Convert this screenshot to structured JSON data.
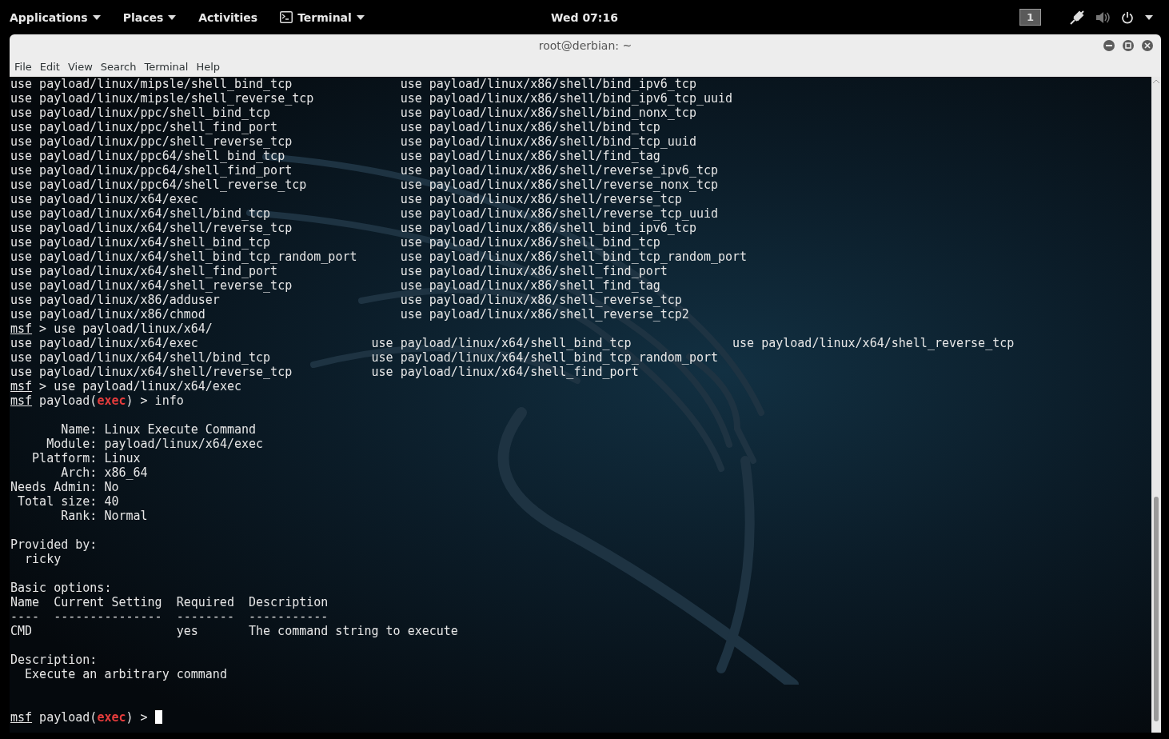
{
  "top_bar": {
    "menus": [
      {
        "label": "Applications",
        "dropdown": true
      },
      {
        "label": "Places",
        "dropdown": true
      },
      {
        "label": "Activities",
        "dropdown": false
      },
      {
        "label": "Terminal",
        "dropdown": true,
        "app_icon": true
      }
    ],
    "clock": "Wed 07:16",
    "workspace": "1"
  },
  "window": {
    "title": "root@derbian: ~",
    "menu": [
      "File",
      "Edit",
      "View",
      "Search",
      "Terminal",
      "Help"
    ]
  },
  "terminal": {
    "lines": [
      {
        "kind": "wide-listing",
        "cells": [
          "use payload/linux/mipsle/shell_bind_tcp",
          "use payload/linux/x86/shell/bind_ipv6_tcp"
        ]
      },
      {
        "kind": "wide-listing",
        "cells": [
          "use payload/linux/mipsle/shell_reverse_tcp",
          "use payload/linux/x86/shell/bind_ipv6_tcp_uuid"
        ]
      },
      {
        "kind": "wide-listing",
        "cells": [
          "use payload/linux/ppc/shell_bind_tcp",
          "use payload/linux/x86/shell/bind_nonx_tcp"
        ]
      },
      {
        "kind": "wide-listing",
        "cells": [
          "use payload/linux/ppc/shell_find_port",
          "use payload/linux/x86/shell/bind_tcp"
        ]
      },
      {
        "kind": "wide-listing",
        "cells": [
          "use payload/linux/ppc/shell_reverse_tcp",
          "use payload/linux/x86/shell/bind_tcp_uuid"
        ]
      },
      {
        "kind": "wide-listing",
        "cells": [
          "use payload/linux/ppc64/shell_bind_tcp",
          "use payload/linux/x86/shell/find_tag"
        ]
      },
      {
        "kind": "wide-listing",
        "cells": [
          "use payload/linux/ppc64/shell_find_port",
          "use payload/linux/x86/shell/reverse_ipv6_tcp"
        ]
      },
      {
        "kind": "wide-listing",
        "cells": [
          "use payload/linux/ppc64/shell_reverse_tcp",
          "use payload/linux/x86/shell/reverse_nonx_tcp"
        ]
      },
      {
        "kind": "wide-listing",
        "cells": [
          "use payload/linux/x64/exec",
          "use payload/linux/x86/shell/reverse_tcp"
        ]
      },
      {
        "kind": "wide-listing",
        "cells": [
          "use payload/linux/x64/shell/bind_tcp",
          "use payload/linux/x86/shell/reverse_tcp_uuid"
        ]
      },
      {
        "kind": "wide-listing",
        "cells": [
          "use payload/linux/x64/shell/reverse_tcp",
          "use payload/linux/x86/shell_bind_ipv6_tcp"
        ]
      },
      {
        "kind": "wide-listing",
        "cells": [
          "use payload/linux/x64/shell_bind_tcp",
          "use payload/linux/x86/shell_bind_tcp"
        ]
      },
      {
        "kind": "wide-listing",
        "cells": [
          "use payload/linux/x64/shell_bind_tcp_random_port",
          "use payload/linux/x86/shell_bind_tcp_random_port"
        ]
      },
      {
        "kind": "wide-listing",
        "cells": [
          "use payload/linux/x64/shell_find_port",
          "use payload/linux/x86/shell_find_port"
        ]
      },
      {
        "kind": "wide-listing",
        "cells": [
          "use payload/linux/x64/shell_reverse_tcp",
          "use payload/linux/x86/shell_find_tag"
        ]
      },
      {
        "kind": "wide-listing",
        "cells": [
          "use payload/linux/x86/adduser",
          "use payload/linux/x86/shell_reverse_tcp"
        ]
      },
      {
        "kind": "wide-listing",
        "cells": [
          "use payload/linux/x86/chmod",
          "use payload/linux/x86/shell_reverse_tcp2"
        ]
      },
      {
        "kind": "prompt",
        "prompt": "msf",
        "parts": [
          " > use payload/linux/x64/"
        ]
      },
      {
        "kind": "listing",
        "cells": [
          "use payload/linux/x64/exec",
          "use payload/linux/x64/shell_bind_tcp",
          "use payload/linux/x64/shell_reverse_tcp"
        ]
      },
      {
        "kind": "listing",
        "cells": [
          "use payload/linux/x64/shell/bind_tcp",
          "use payload/linux/x64/shell_bind_tcp_random_port"
        ]
      },
      {
        "kind": "listing",
        "cells": [
          "use payload/linux/x64/shell/reverse_tcp",
          "use payload/linux/x64/shell_find_port"
        ]
      },
      {
        "kind": "prompt",
        "prompt": "msf",
        "parts": [
          " > use payload/linux/x64/exec"
        ]
      },
      {
        "kind": "prompt",
        "prompt": "msf",
        "parts": [
          " payload(",
          "exec",
          ") > info"
        ]
      },
      {
        "kind": "blank"
      },
      {
        "kind": "text",
        "text": "       Name: Linux Execute Command"
      },
      {
        "kind": "text",
        "text": "     Module: payload/linux/x64/exec"
      },
      {
        "kind": "text",
        "text": "   Platform: Linux"
      },
      {
        "kind": "text",
        "text": "       Arch: x86_64"
      },
      {
        "kind": "text",
        "text": "Needs Admin: No"
      },
      {
        "kind": "text",
        "text": " Total size: 40"
      },
      {
        "kind": "text",
        "text": "       Rank: Normal"
      },
      {
        "kind": "blank"
      },
      {
        "kind": "text",
        "text": "Provided by:"
      },
      {
        "kind": "text",
        "text": "  ricky"
      },
      {
        "kind": "blank"
      },
      {
        "kind": "text",
        "text": "Basic options:"
      },
      {
        "kind": "table",
        "cells": [
          "Name",
          "Current Setting",
          "Required",
          "Description"
        ]
      },
      {
        "kind": "table",
        "cells": [
          "----",
          "---------------",
          "--------",
          "-----------"
        ]
      },
      {
        "kind": "table",
        "cells": [
          "CMD",
          "",
          "yes",
          "The command string to execute"
        ]
      },
      {
        "kind": "blank"
      },
      {
        "kind": "text",
        "text": "Description:"
      },
      {
        "kind": "text",
        "text": "  Execute an arbitrary command"
      },
      {
        "kind": "blank"
      },
      {
        "kind": "blank"
      },
      {
        "kind": "prompt",
        "cursor": true,
        "prompt": "msf",
        "parts": [
          " payload(",
          "exec",
          ") > "
        ]
      }
    ]
  }
}
